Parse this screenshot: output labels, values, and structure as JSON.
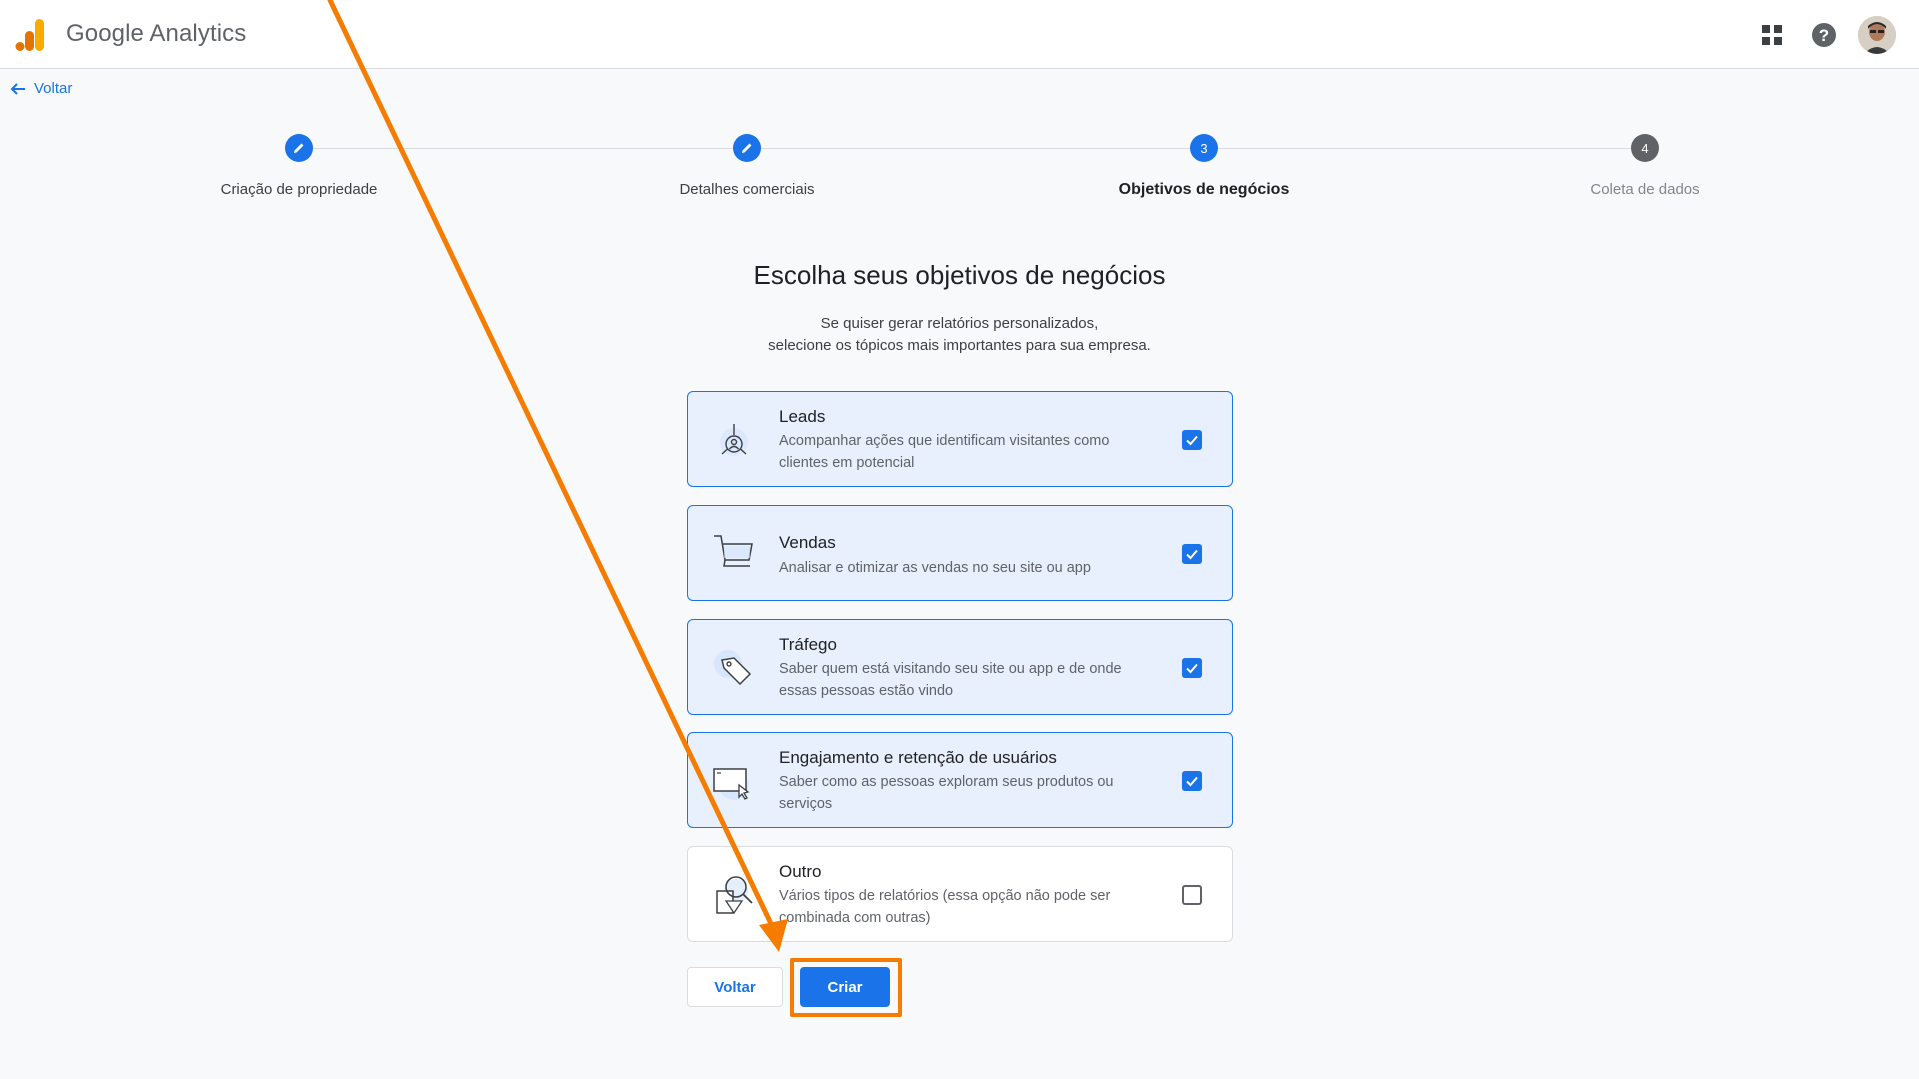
{
  "app": {
    "brand": "Google Analytics"
  },
  "topbar": {
    "apps_icon": "apps-grid-icon",
    "help_icon": "help-circle-icon",
    "avatar_icon": "user-avatar"
  },
  "back_link": {
    "label": "Voltar",
    "icon": "arrow-left-icon"
  },
  "stepper": {
    "steps": [
      {
        "label": "Criação de propriedade",
        "state": "done",
        "number": "1"
      },
      {
        "label": "Detalhes comerciais",
        "state": "done",
        "number": "2"
      },
      {
        "label": "Objetivos de negócios",
        "state": "active",
        "number": "3"
      },
      {
        "label": "Coleta de dados",
        "state": "todo",
        "number": "4"
      }
    ]
  },
  "main": {
    "heading": "Escolha seus objetivos de negócios",
    "subtext_line1": "Se quiser gerar relatórios personalizados,",
    "subtext_line2": "selecione os tópicos mais importantes para sua empresa."
  },
  "options": [
    {
      "title": "Leads",
      "desc": "Acompanhar ações que identificam visitantes como clientes em potencial",
      "checked": true,
      "icon": "leads-icon"
    },
    {
      "title": "Vendas",
      "desc": "Analisar e otimizar as vendas no seu site ou app",
      "checked": true,
      "icon": "shopping-cart-icon"
    },
    {
      "title": "Tráfego",
      "desc": "Saber quem está visitando seu site ou app e de onde essas pessoas estão vindo",
      "checked": true,
      "icon": "tag-icon"
    },
    {
      "title": "Engajamento e retenção de usuários",
      "desc": "Saber como as pessoas exploram seus produtos ou serviços",
      "checked": true,
      "icon": "browser-cursor-icon"
    },
    {
      "title": "Outro",
      "desc": "Vários tipos de relatórios (essa opção não pode ser combinada com outras)",
      "checked": false,
      "icon": "magnifier-shapes-icon"
    }
  ],
  "buttons": {
    "back_label": "Voltar",
    "create_label": "Criar"
  },
  "colors": {
    "accent": "#1a73e8",
    "annotation": "#f57c00",
    "selected_bg": "#e8f0fe"
  }
}
